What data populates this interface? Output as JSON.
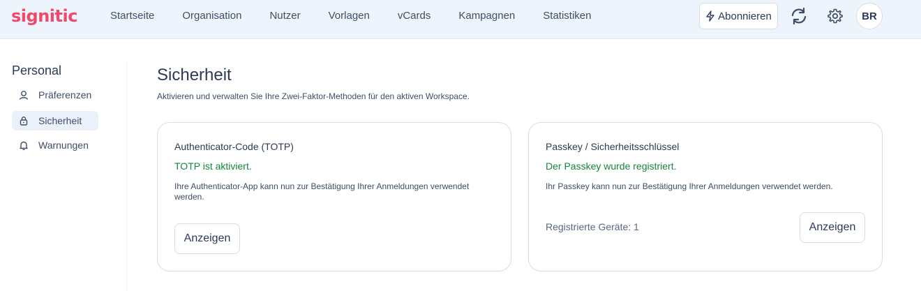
{
  "app": {
    "logo_text": "signitic",
    "colors": {
      "brand": "#ef4a6b",
      "success": "#14853a",
      "topbar_bg": "#eef4fb"
    }
  },
  "nav": {
    "items": [
      {
        "label": "Startseite"
      },
      {
        "label": "Organisation"
      },
      {
        "label": "Nutzer"
      },
      {
        "label": "Vorlagen"
      },
      {
        "label": "vCards"
      },
      {
        "label": "Kampagnen"
      },
      {
        "label": "Statistiken"
      }
    ],
    "subscribe_label": "Abonnieren",
    "subscribe_icon": "lightning-icon",
    "sync_icon": "sync-icon",
    "settings_icon": "gear-icon",
    "avatar_initials": "BR"
  },
  "sidebar": {
    "title": "Personal",
    "items": [
      {
        "label": "Präferenzen",
        "icon": "user-icon",
        "active": false
      },
      {
        "label": "Sicherheit",
        "icon": "lock-icon",
        "active": true
      },
      {
        "label": "Warnungen",
        "icon": "bell-icon",
        "active": false
      }
    ]
  },
  "main": {
    "title": "Sicherheit",
    "subtitle": "Aktivieren und verwalten Sie Ihre Zwei-Faktor-Methoden für den aktiven Workspace.",
    "cards": [
      {
        "title": "Authenticator-Code (TOTP)",
        "status": "TOTP ist aktiviert.",
        "description": "Ihre Authenticator-App kann nun zur Bestätigung Ihrer Anmeldungen verwendet werden.",
        "button_label": "Anzeigen"
      },
      {
        "title": "Passkey / Sicherheitsschlüssel",
        "status": "Der Passkey wurde registriert.",
        "description": "Ihr Passkey kann nun zur Bestätigung Ihrer Anmeldungen verwendet werden.",
        "devices_label": "Registrierte Geräte: 1",
        "button_label": "Anzeigen"
      }
    ]
  }
}
